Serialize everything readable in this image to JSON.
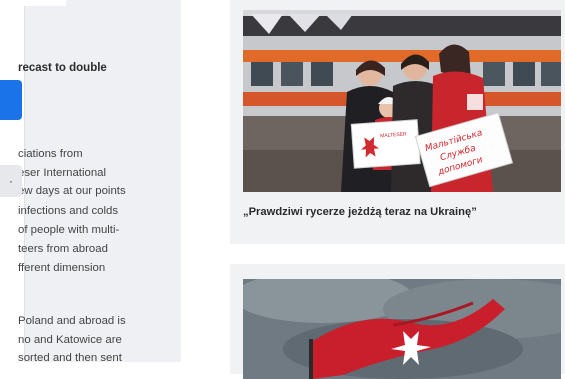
{
  "sidebar": {
    "heading": "recast to double",
    "paragraph_1": [
      "ciations from",
      "eser International",
      "ew days at our points",
      "infections and colds",
      " of people with multi-",
      "teers from abroad",
      "fferent dimension"
    ],
    "select_value": "·",
    "paragraph_2": [
      "Poland and abroad is",
      "no and Katowice are",
      "sorted and then sent"
    ]
  },
  "articles": [
    {
      "title": "„Prawdziwi rycerze jeżdżą teraz na Ukrainę”",
      "photo_sign_text": "Мальтійська Служба допомоги",
      "photo_small_sign_text": "MALTESER"
    },
    {
      "title": ""
    }
  ]
}
